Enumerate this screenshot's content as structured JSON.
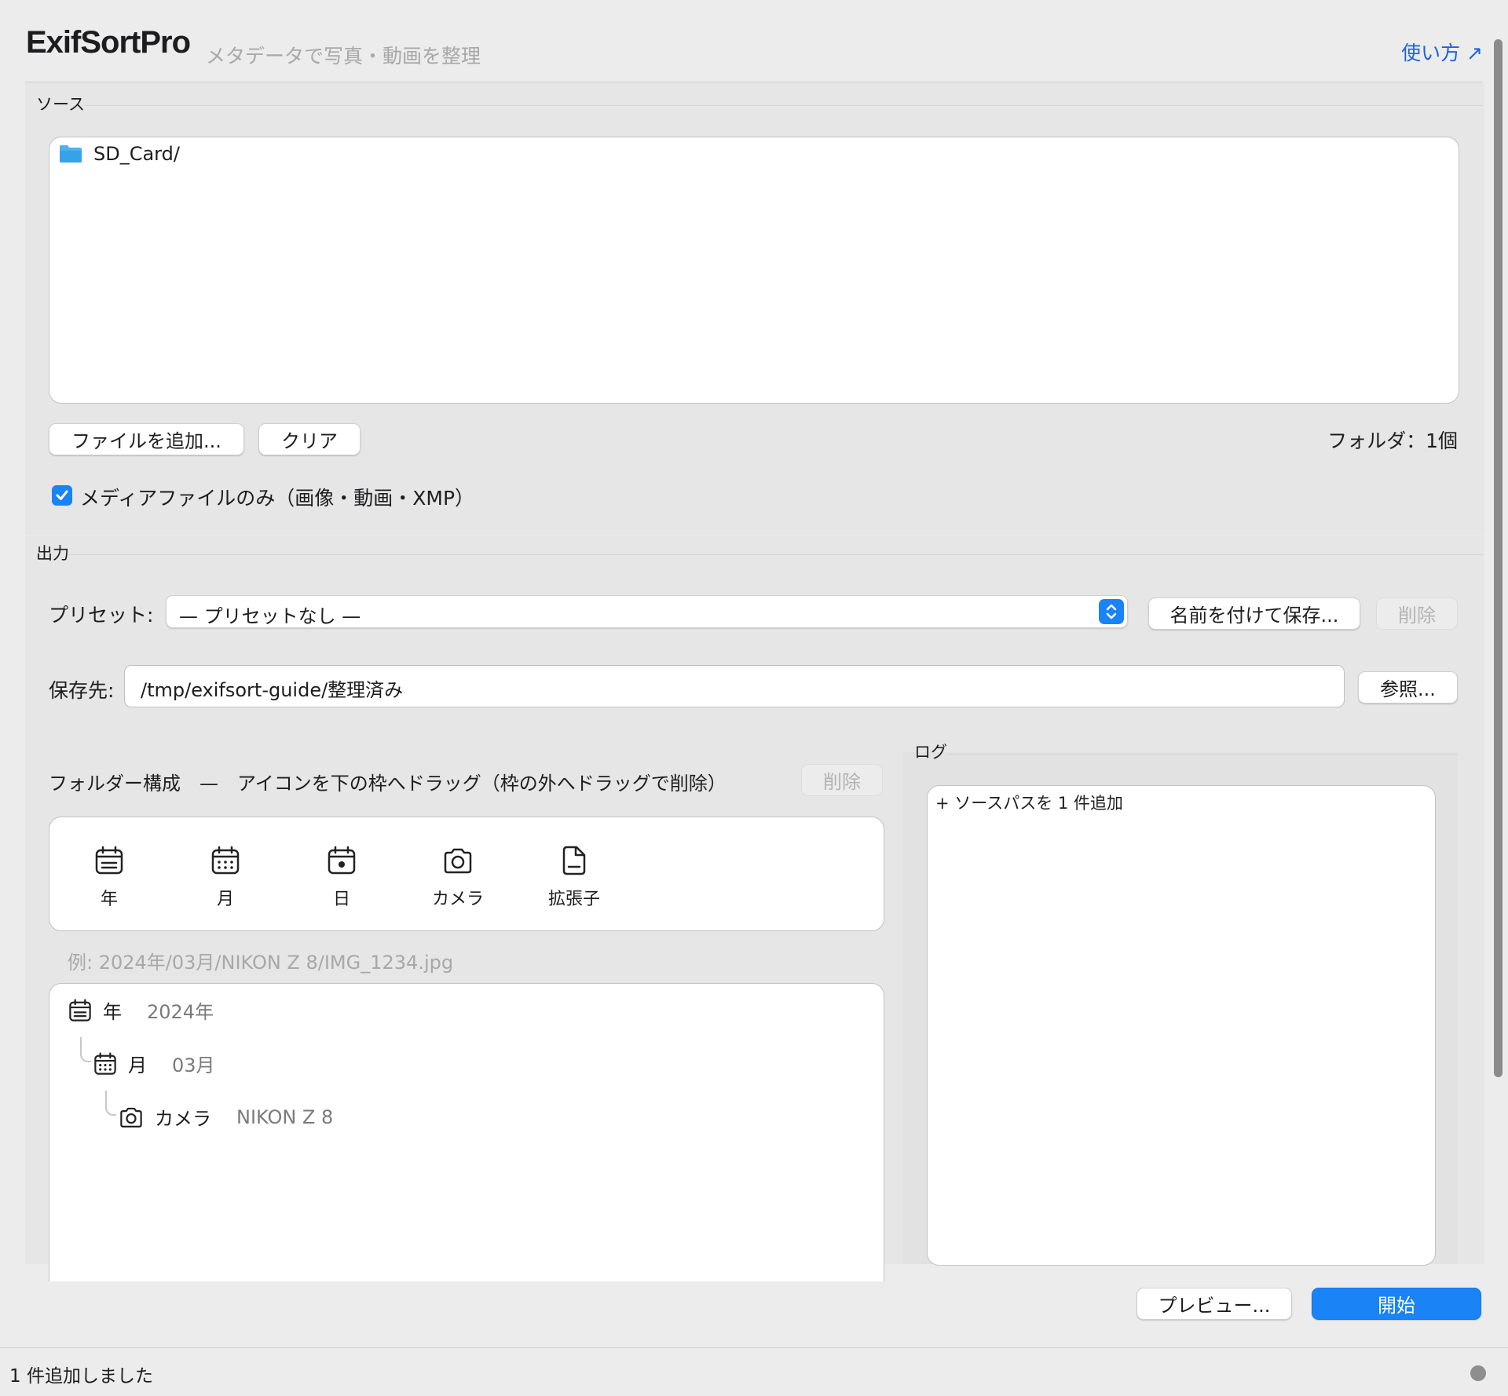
{
  "header": {
    "title": "ExifSortPro",
    "subtitle": "メタデータで写真・動画を整理",
    "help_link": "使い方 ↗"
  },
  "source": {
    "section_label": "ソース",
    "items": [
      {
        "name": "SD_Card/",
        "icon": "folder-icon"
      }
    ],
    "add_files_button": "ファイルを追加...",
    "clear_button": "クリア",
    "folder_count": "フォルダ：1個",
    "media_only_checked": true,
    "media_only_label": "メディアファイルのみ（画像・動画・XMP）"
  },
  "output": {
    "section_label": "出力",
    "preset_label": "プリセット:",
    "preset_value": "— プリセットなし —",
    "save_as_button": "名前を付けて保存...",
    "delete_preset_button": "削除",
    "destination_label": "保存先:",
    "destination_value": "/tmp/exifsort-guide/整理済み",
    "browse_button": "参照...",
    "folder_structure_label": "フォルダー構成　—　アイコンを下の枠へドラッグ（枠の外へドラッグで削除）",
    "delete_structure_button": "削除",
    "palette": [
      {
        "label": "年",
        "icon": "calendar-year-icon"
      },
      {
        "label": "月",
        "icon": "calendar-month-icon"
      },
      {
        "label": "日",
        "icon": "calendar-day-icon"
      },
      {
        "label": "カメラ",
        "icon": "camera-icon"
      },
      {
        "label": "拡張子",
        "icon": "document-icon"
      }
    ],
    "example_path": "例: 2024年/03月/NIKON Z 8/IMG_1234.jpg",
    "tree": [
      {
        "key": "年",
        "value": "2024年",
        "icon": "calendar-year-icon"
      },
      {
        "key": "月",
        "value": "03月",
        "icon": "calendar-month-icon"
      },
      {
        "key": "カメラ",
        "value": "NIKON Z 8",
        "icon": "camera-icon"
      }
    ]
  },
  "log": {
    "section_label": "ログ",
    "lines": [
      "+ ソースパスを 1 件追加"
    ]
  },
  "actions": {
    "preview_button": "プレビュー...",
    "start_button": "開始"
  },
  "status": {
    "text": "1 件追加しました"
  },
  "colors": {
    "accent": "#1a83f5",
    "link": "#1b64d6",
    "background": "#ececec"
  }
}
